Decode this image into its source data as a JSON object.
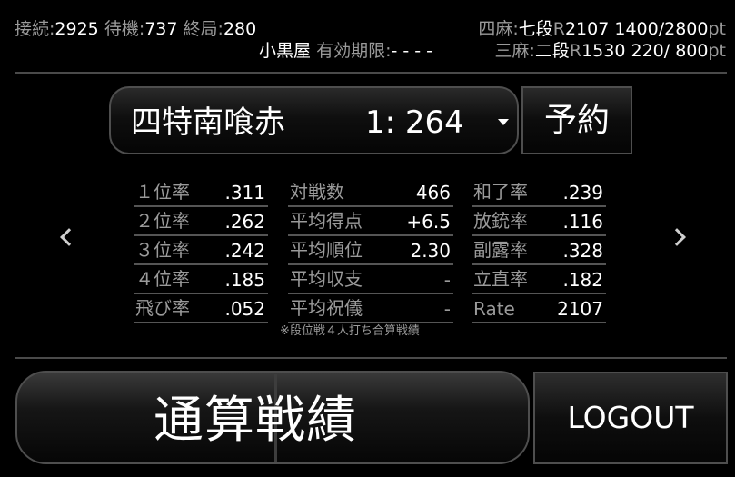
{
  "header": {
    "connected_label": "接続:",
    "connected_value": "2925",
    "waiting_label": "待機:",
    "waiting_value": "737",
    "finished_label": "終局:",
    "finished_value": "280",
    "username": "小黒屋",
    "expiry_label": "有効期限:",
    "expiry_value": "- - - -",
    "four_player": {
      "label": "四麻:",
      "rank": "七段",
      "r_prefix": "R",
      "rating": "2107",
      "points": "1400",
      "points_max": "/2800",
      "unit": "pt"
    },
    "three_player": {
      "label": "三麻:",
      "rank": "二段",
      "r_prefix": "R",
      "rating": "1530",
      "points": "220",
      "points_max": "/ 800",
      "unit": "pt"
    }
  },
  "mode": {
    "label": "四特南喰赤",
    "count": "1: 264"
  },
  "reserve_button": "予約",
  "stats": {
    "col1": [
      {
        "label": "１位率",
        "value": ".311"
      },
      {
        "label": "２位率",
        "value": ".262"
      },
      {
        "label": "３位率",
        "value": ".242"
      },
      {
        "label": "４位率",
        "value": ".185"
      },
      {
        "label": "飛び率",
        "value": ".052"
      }
    ],
    "col2": [
      {
        "label": "対戦数",
        "value": "466"
      },
      {
        "label": "平均得点",
        "value": "+6.5"
      },
      {
        "label": "平均順位",
        "value": "2.30"
      },
      {
        "label": "平均収支",
        "value": "-"
      },
      {
        "label": "平均祝儀",
        "value": "-"
      }
    ],
    "col3": [
      {
        "label": "和了率",
        "value": ".239"
      },
      {
        "label": "放銃率",
        "value": ".116"
      },
      {
        "label": "副露率",
        "value": ".328"
      },
      {
        "label": "立直率",
        "value": ".182"
      },
      {
        "label": "Rate",
        "value": "2107"
      }
    ]
  },
  "footnote": "※段位戦４人打ち合算戦績",
  "total_button": "通算戦績",
  "logout_button": "LOGOUT"
}
